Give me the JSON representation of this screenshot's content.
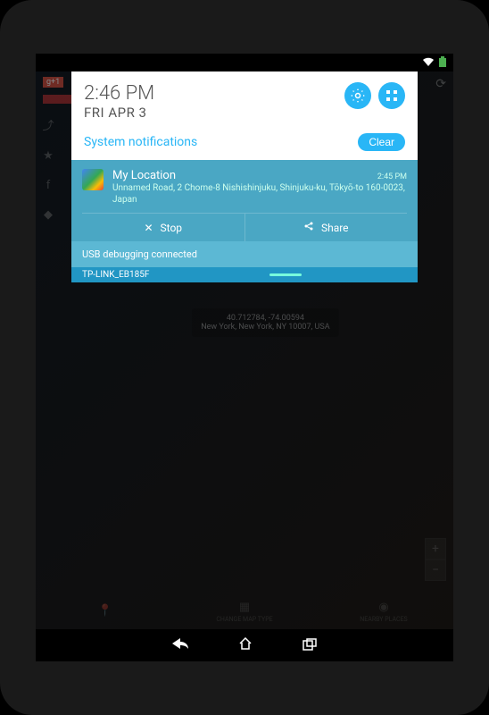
{
  "status": {
    "wifi": "wifi",
    "battery": "battery"
  },
  "panel": {
    "time": "2:46 PM",
    "date": "FRI APR 3",
    "subheader": "System notifications",
    "clear_label": "Clear"
  },
  "notification": {
    "title": "My Location",
    "time": "2:45 PM",
    "body": "Unnamed Road, 2 Chome-8 Nishishinjuku, Shinjuku-ku, Tōkyō-to 160-0023, Japan",
    "stop_label": "Stop",
    "share_label": "Share"
  },
  "next_notification": {
    "text": "USB debugging connected"
  },
  "ticker": {
    "text": "TP-LINK_EB185F"
  },
  "map_marker": {
    "coords": "40.712784, -74.00594",
    "address": "New York, New York, NY 10007, USA"
  },
  "tabs": {
    "location": "",
    "map_type": "CHANGE MAP TYPE",
    "nearby": "NEARBY PLACES"
  },
  "g_plus": "g+1"
}
